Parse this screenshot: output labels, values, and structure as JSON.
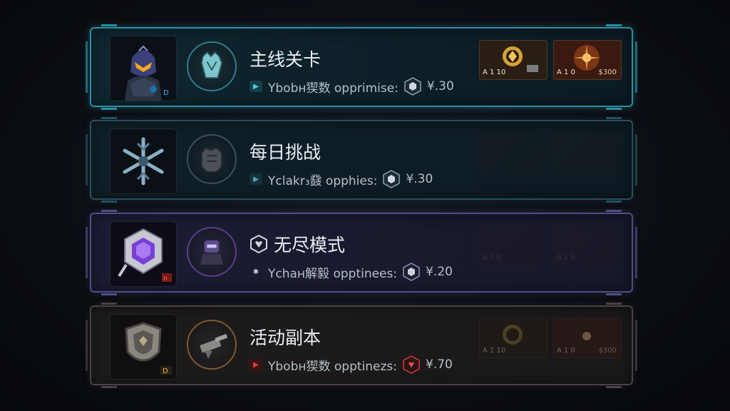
{
  "modes": [
    {
      "title": "主线关卡",
      "subtitle": "Ybobн猰数 opprimise:",
      "value": "¥.30",
      "thumbs": [
        {
          "left": "A 1 10",
          "right": ""
        },
        {
          "left": "A 1 0",
          "right": "$300"
        }
      ]
    },
    {
      "title": "每日挑战",
      "subtitle": "Yclakr₃鼗 opphies:",
      "value": "¥.30"
    },
    {
      "title": "无尽模式",
      "subtitle": "Ychaн解毅 opptinees:",
      "value": "¥.20",
      "thumbs": [
        {
          "left": "A 1 0",
          "right": ""
        },
        {
          "left": "A 1 0",
          "right": ""
        }
      ]
    },
    {
      "title": "活动副本",
      "subtitle": "Ybobн猰数 opptinezs:",
      "value": "¥.70",
      "thumbs": [
        {
          "left": "A 1 10",
          "right": ""
        },
        {
          "left": "A 1 0",
          "right": "$300"
        }
      ]
    }
  ],
  "colors": {
    "accent_cyan": "#2b8fa3",
    "accent_purple": "#4e4e86",
    "accent_red": "#d23a3a",
    "thumb_gold": "#d8a23a"
  }
}
